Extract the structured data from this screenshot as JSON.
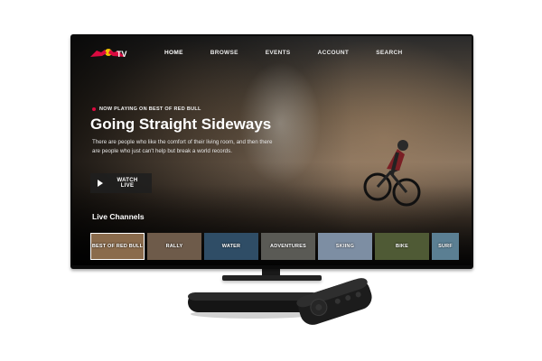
{
  "nav": {
    "logo_alt": "Red Bull TV",
    "items": [
      "HOME",
      "BROWSE",
      "EVENTS",
      "ACCOUNT",
      "SEARCH"
    ],
    "active_index": 0
  },
  "hero": {
    "now_playing": "NOW PLAYING ON BEST OF RED BULL",
    "title": "Going Straight Sideways",
    "description": "There are people who like the comfort of their living room, and then there are people who just can't help but break a world records.",
    "watch_button": "WATCH LIVE"
  },
  "live_channels": {
    "title": "Live Channels",
    "items": [
      {
        "label": "BEST OF RED BULL",
        "color": "#8a6b4c"
      },
      {
        "label": "RALLY",
        "color": "#6e5b4a"
      },
      {
        "label": "WATER",
        "color": "#2f4d66"
      },
      {
        "label": "ADVENTURES",
        "color": "#5a5a55"
      },
      {
        "label": "SKIING",
        "color": "#7d8ea3"
      },
      {
        "label": "BIKE",
        "color": "#4f5a35"
      },
      {
        "label": "SURF",
        "color": "#5b7f93"
      }
    ]
  },
  "colors": {
    "accent": "#db0a40"
  }
}
